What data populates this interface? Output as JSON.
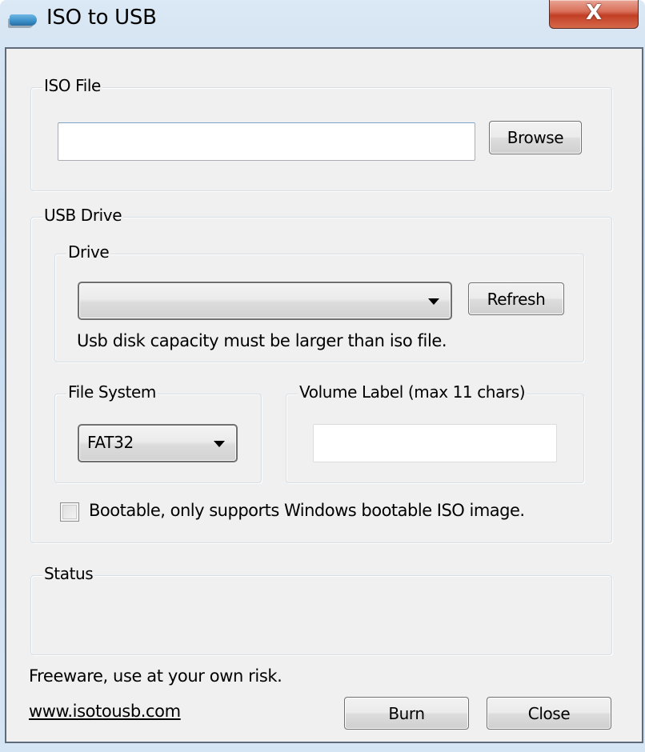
{
  "window": {
    "title": "ISO to USB",
    "app_icon": "usb-drive-icon",
    "close_icon": "close-icon",
    "close_glyph": "X"
  },
  "iso_file": {
    "group_label": "ISO File",
    "path_value": "",
    "browse_label": "Browse"
  },
  "usb_drive": {
    "group_label": "USB Drive",
    "drive": {
      "group_label": "Drive",
      "selected_value": "",
      "refresh_label": "Refresh",
      "hint": "Usb disk capacity must be larger than iso file."
    },
    "file_system": {
      "group_label": "File System",
      "selected_value": "FAT32"
    },
    "volume_label": {
      "group_label": "Volume Label (max 11 chars)",
      "value": ""
    },
    "bootable": {
      "label": "Bootable, only supports Windows bootable ISO image.",
      "checked": false
    }
  },
  "status": {
    "group_label": "Status",
    "text": ""
  },
  "footer": {
    "disclaimer": "Freeware, use at your own risk.",
    "website_link": "www.isotousb.com",
    "burn_label": "Burn",
    "close_label": "Close"
  }
}
